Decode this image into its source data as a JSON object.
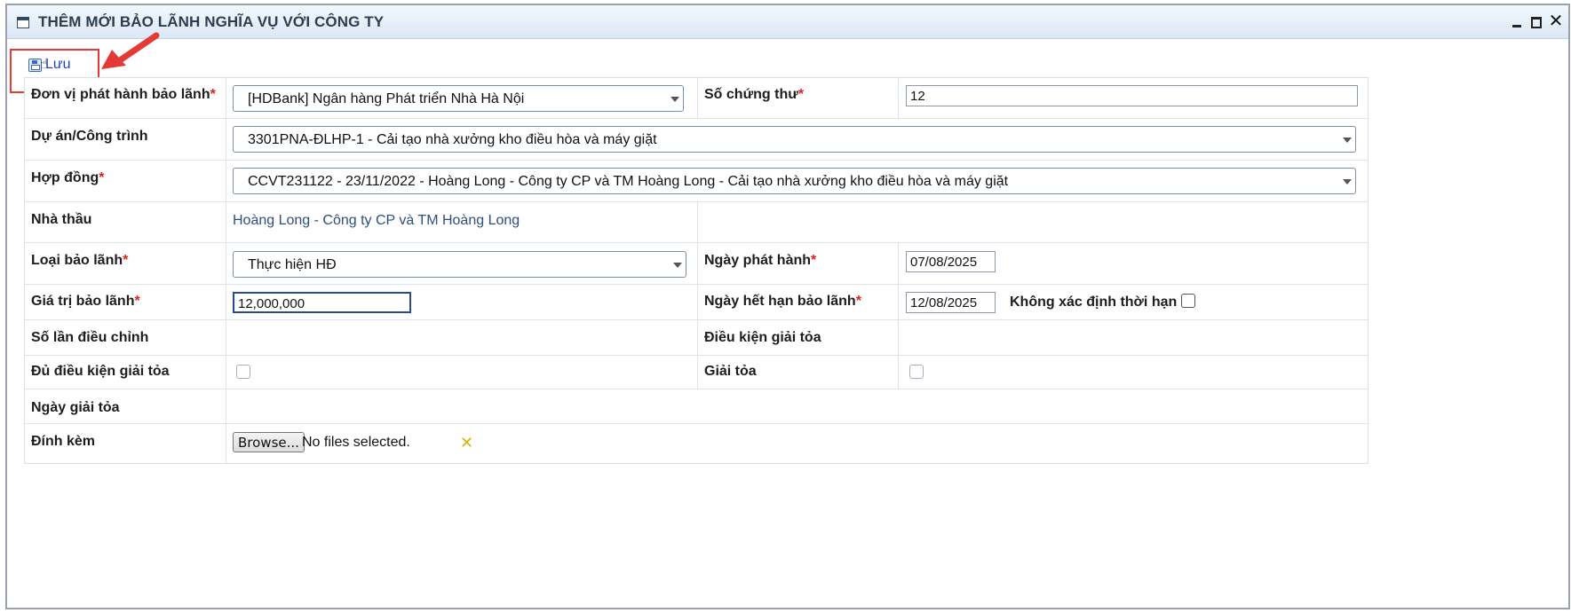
{
  "window": {
    "title": "THÊM MỚI BẢO LÃNH NGHĨA VỤ VỚI CÔNG TY",
    "icons": [
      "window-icon",
      "minimize-icon",
      "maximize-icon",
      "close-icon"
    ],
    "close_glyph": "✕"
  },
  "toolbar": {
    "save_label": "Lưu",
    "save_icon": "floppy-disk-icon"
  },
  "form": {
    "issuer": {
      "label": "Đơn vị phát hành bảo lãnh",
      "required": "*",
      "value": "[HDBank] Ngân hàng Phát triển Nhà Hà Nội"
    },
    "certificate_no": {
      "label": "Số chứng thư",
      "required": "*",
      "value": "12"
    },
    "project": {
      "label": "Dự án/Công trình",
      "value": "3301PNA-ĐLHP-1 - Cải tạo nhà xưởng kho điều hòa và máy giặt"
    },
    "contract": {
      "label": "Hợp đồng",
      "required": "*",
      "value": "CCVT231122 - 23/11/2022 - Hoàng Long - Công ty CP và TM Hoàng Long - Cải tạo nhà xưởng kho điều hòa và máy giặt"
    },
    "contractor": {
      "label": "Nhà thầu",
      "value": "Hoàng Long - Công ty CP và TM Hoàng Long"
    },
    "guarantee_type": {
      "label": "Loại bảo lãnh",
      "required": "*",
      "value": "Thực hiện HĐ"
    },
    "issue_date": {
      "label": "Ngày phát hành",
      "required": "*",
      "value": "07/08/2025"
    },
    "guarantee_value": {
      "label": "Giá trị bảo lãnh",
      "required": "*",
      "value": "12,000,000"
    },
    "expiry_date": {
      "label": "Ngày hết hạn bảo lãnh",
      "required": "*",
      "value": "12/08/2025"
    },
    "indefinite": {
      "label": "Không xác định thời hạn",
      "checked": false
    },
    "adjust_count": {
      "label": "Số lần điều chỉnh"
    },
    "release_condition": {
      "label": "Điều kiện giải tỏa"
    },
    "eligible_release": {
      "label": "Đủ điều kiện giải tỏa",
      "checked": false
    },
    "released": {
      "label": "Giải tỏa",
      "checked": false
    },
    "release_date": {
      "label": "Ngày giải tỏa"
    },
    "attachment": {
      "label": "Đính kèm",
      "browse_label": "Browse...",
      "status": "No files selected.",
      "clear_glyph": "✕"
    }
  },
  "annotation": {
    "highlight_color": "#e53935"
  }
}
